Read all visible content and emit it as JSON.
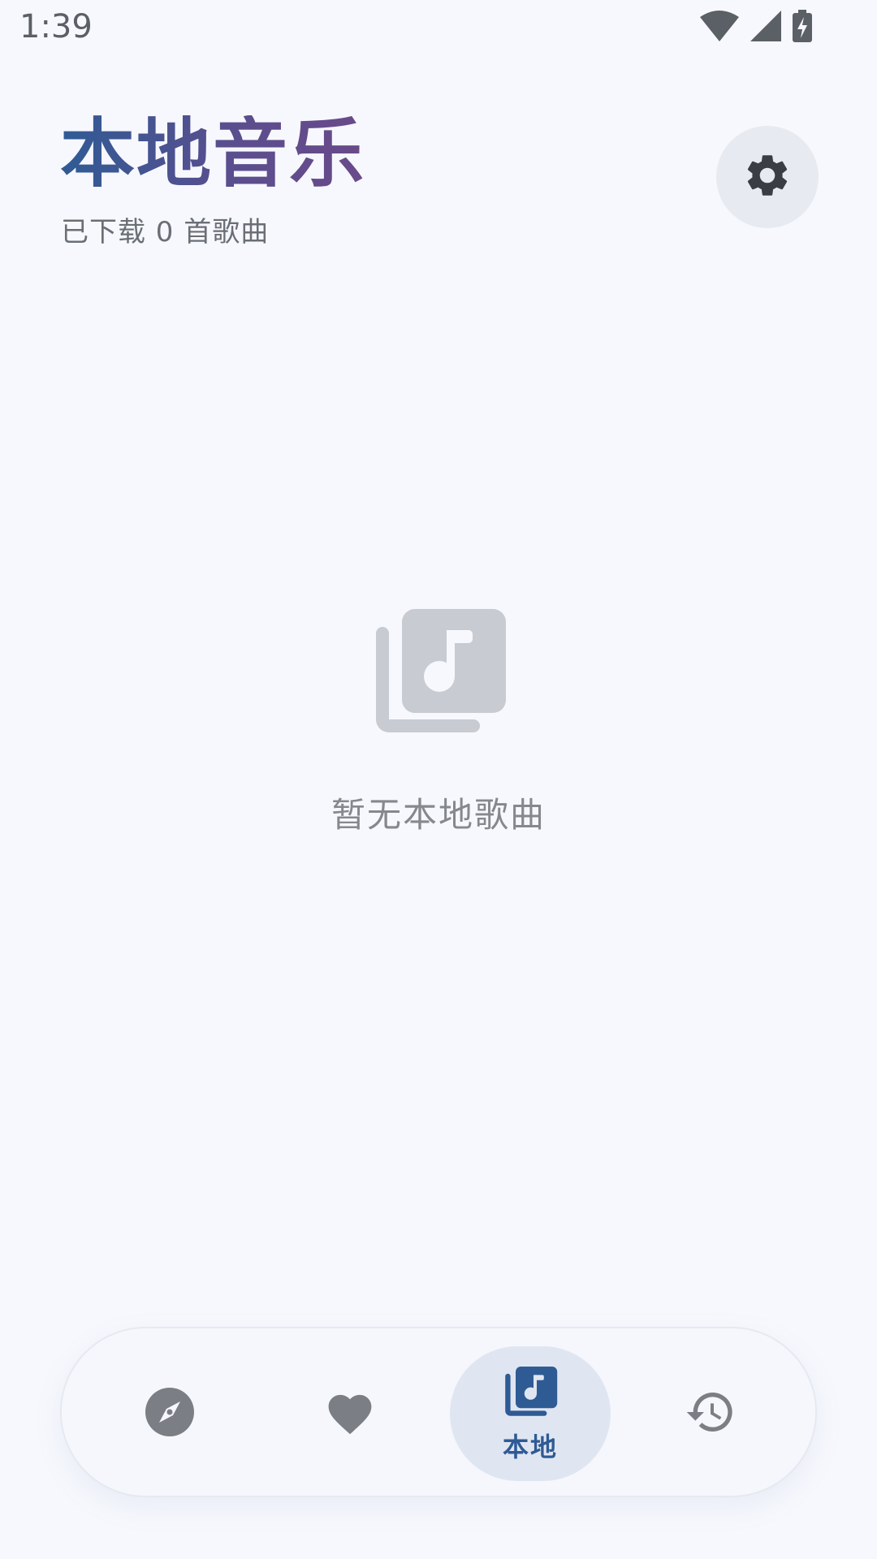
{
  "status_bar": {
    "time": "1:39",
    "icons": [
      "wifi-icon",
      "signal-icon",
      "battery-charging-icon"
    ]
  },
  "header": {
    "title": "本地音乐",
    "subtitle": "已下载 0 首歌曲",
    "settings_icon": "gear-icon"
  },
  "empty_state": {
    "icon": "library-music-icon",
    "message": "暂无本地歌曲"
  },
  "bottom_nav": {
    "items": [
      {
        "icon": "compass-icon",
        "label": "",
        "active": false
      },
      {
        "icon": "heart-icon",
        "label": "",
        "active": false
      },
      {
        "icon": "library-music-icon",
        "label": "本地",
        "active": true
      },
      {
        "icon": "history-icon",
        "label": "",
        "active": false
      }
    ]
  },
  "colors": {
    "background": "#f7f8fd",
    "accent": "#2f5b95",
    "title_gradient_end": "#6a4a8a",
    "icon_gray": "#7b7e84",
    "empty_icon": "#c8cbd1"
  }
}
